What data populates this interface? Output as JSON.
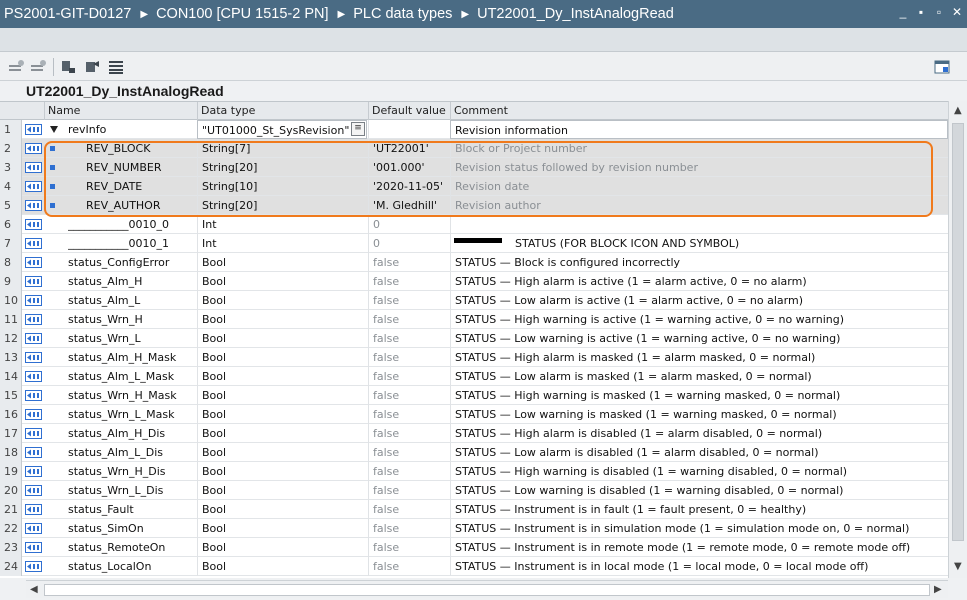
{
  "breadcrumb": [
    "PS2001-GIT-D0127",
    "CON100 [CPU 1515-2 PN]",
    "PLC data types",
    "UT22001_Dy_InstAnalogRead"
  ],
  "block_title": "UT22001_Dy_InstAnalogRead",
  "columns": {
    "name": "Name",
    "data_type": "Data type",
    "default_value": "Default value",
    "comment": "Comment"
  },
  "rows": [
    {
      "n": "1",
      "name": "revInfo",
      "type": "\"UT01000_St_SysRevision\"",
      "def": "",
      "comment": "Revision information"
    },
    {
      "n": "2",
      "name": "REV_BLOCK",
      "type": "String[7]",
      "def": "'UT22001'",
      "comment": "Block or Project number"
    },
    {
      "n": "3",
      "name": "REV_NUMBER",
      "type": "String[20]",
      "def": "'001.000'",
      "comment": "Revision status followed by revision number"
    },
    {
      "n": "4",
      "name": "REV_DATE",
      "type": "String[10]",
      "def": "'2020-11-05'",
      "comment": "Revision date"
    },
    {
      "n": "5",
      "name": "REV_AUTHOR",
      "type": "String[20]",
      "def": "'M. Gledhill'",
      "comment": "Revision author"
    },
    {
      "n": "6",
      "name": "___________0010_0",
      "type": "Int",
      "def": "0",
      "comment": ""
    },
    {
      "n": "7",
      "name": "___________0010_1",
      "type": "Int",
      "def": "0",
      "comment": "STATUS (FOR BLOCK ICON AND SYMBOL)"
    },
    {
      "n": "8",
      "name": "status_ConfigError",
      "type": "Bool",
      "def": "false",
      "comment": "STATUS — Block is configured incorrectly"
    },
    {
      "n": "9",
      "name": "status_Alm_H",
      "type": "Bool",
      "def": "false",
      "comment": "STATUS — High alarm is active (1 = alarm active, 0 = no alarm)"
    },
    {
      "n": "10",
      "name": "status_Alm_L",
      "type": "Bool",
      "def": "false",
      "comment": "STATUS — Low alarm is active (1 = alarm active, 0 = no alarm)"
    },
    {
      "n": "11",
      "name": "status_Wrn_H",
      "type": "Bool",
      "def": "false",
      "comment": "STATUS — High warning is active (1 = warning active, 0 = no warning)"
    },
    {
      "n": "12",
      "name": "status_Wrn_L",
      "type": "Bool",
      "def": "false",
      "comment": "STATUS — Low warning is active (1 = warning active, 0 = no warning)"
    },
    {
      "n": "13",
      "name": "status_Alm_H_Mask",
      "type": "Bool",
      "def": "false",
      "comment": "STATUS — High alarm is masked (1 = alarm masked, 0 = normal)"
    },
    {
      "n": "14",
      "name": "status_Alm_L_Mask",
      "type": "Bool",
      "def": "false",
      "comment": "STATUS — Low alarm is masked (1 = alarm masked, 0 = normal)"
    },
    {
      "n": "15",
      "name": "status_Wrn_H_Mask",
      "type": "Bool",
      "def": "false",
      "comment": "STATUS — High warning is masked (1 = warning masked, 0 = normal)"
    },
    {
      "n": "16",
      "name": "status_Wrn_L_Mask",
      "type": "Bool",
      "def": "false",
      "comment": "STATUS — Low warning is masked (1 = warning masked, 0 = normal)"
    },
    {
      "n": "17",
      "name": "status_Alm_H_Dis",
      "type": "Bool",
      "def": "false",
      "comment": "STATUS — High alarm is disabled (1 = alarm disabled, 0 = normal)"
    },
    {
      "n": "18",
      "name": "status_Alm_L_Dis",
      "type": "Bool",
      "def": "false",
      "comment": "STATUS — Low alarm is disabled (1 = alarm disabled, 0 = normal)"
    },
    {
      "n": "19",
      "name": "status_Wrn_H_Dis",
      "type": "Bool",
      "def": "false",
      "comment": "STATUS — High warning is disabled (1 = warning disabled, 0 = normal)"
    },
    {
      "n": "20",
      "name": "status_Wrn_L_Dis",
      "type": "Bool",
      "def": "false",
      "comment": "STATUS — Low warning is disabled (1 = warning disabled, 0 = normal)"
    },
    {
      "n": "21",
      "name": "status_Fault",
      "type": "Bool",
      "def": "false",
      "comment": "STATUS — Instrument is in fault (1 = fault present, 0 = healthy)"
    },
    {
      "n": "22",
      "name": "status_SimOn",
      "type": "Bool",
      "def": "false",
      "comment": "STATUS — Instrument is in simulation mode (1 = simulation mode on, 0 = normal)"
    },
    {
      "n": "23",
      "name": "status_RemoteOn",
      "type": "Bool",
      "def": "false",
      "comment": "STATUS — Instrument is in remote mode (1 = remote mode, 0 = remote mode off)"
    },
    {
      "n": "24",
      "name": "status_LocalOn",
      "type": "Bool",
      "def": "false",
      "comment": "STATUS — Instrument is in local mode (1 = local mode, 0 = local mode off)"
    }
  ],
  "colors": {
    "titlebar": "#4a6b84",
    "highlight_box": "#f07a1c",
    "member_marker": "#2f6fd1"
  }
}
